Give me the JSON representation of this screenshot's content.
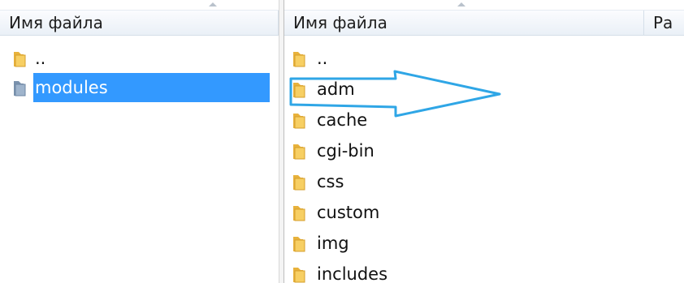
{
  "left_pane": {
    "header": {
      "name_column": "Имя файла"
    },
    "items": [
      {
        "name": "..",
        "icon": "folder-up-icon",
        "selected": false
      },
      {
        "name": "modules",
        "icon": "folder-icon",
        "selected": true
      }
    ]
  },
  "right_pane": {
    "header": {
      "name_column": "Имя файла",
      "next_column": "Ра"
    },
    "items": [
      {
        "name": "..",
        "icon": "folder-up-icon"
      },
      {
        "name": "adm",
        "icon": "folder-icon"
      },
      {
        "name": "cache",
        "icon": "folder-icon"
      },
      {
        "name": "cgi-bin",
        "icon": "folder-icon"
      },
      {
        "name": "css",
        "icon": "folder-icon"
      },
      {
        "name": "custom",
        "icon": "folder-icon"
      },
      {
        "name": "img",
        "icon": "folder-icon"
      },
      {
        "name": "includes",
        "icon": "folder-icon"
      }
    ]
  },
  "colors": {
    "selection": "#3399ff",
    "folder": "#f5c451",
    "annotation_arrow": "#2fa6e6"
  }
}
